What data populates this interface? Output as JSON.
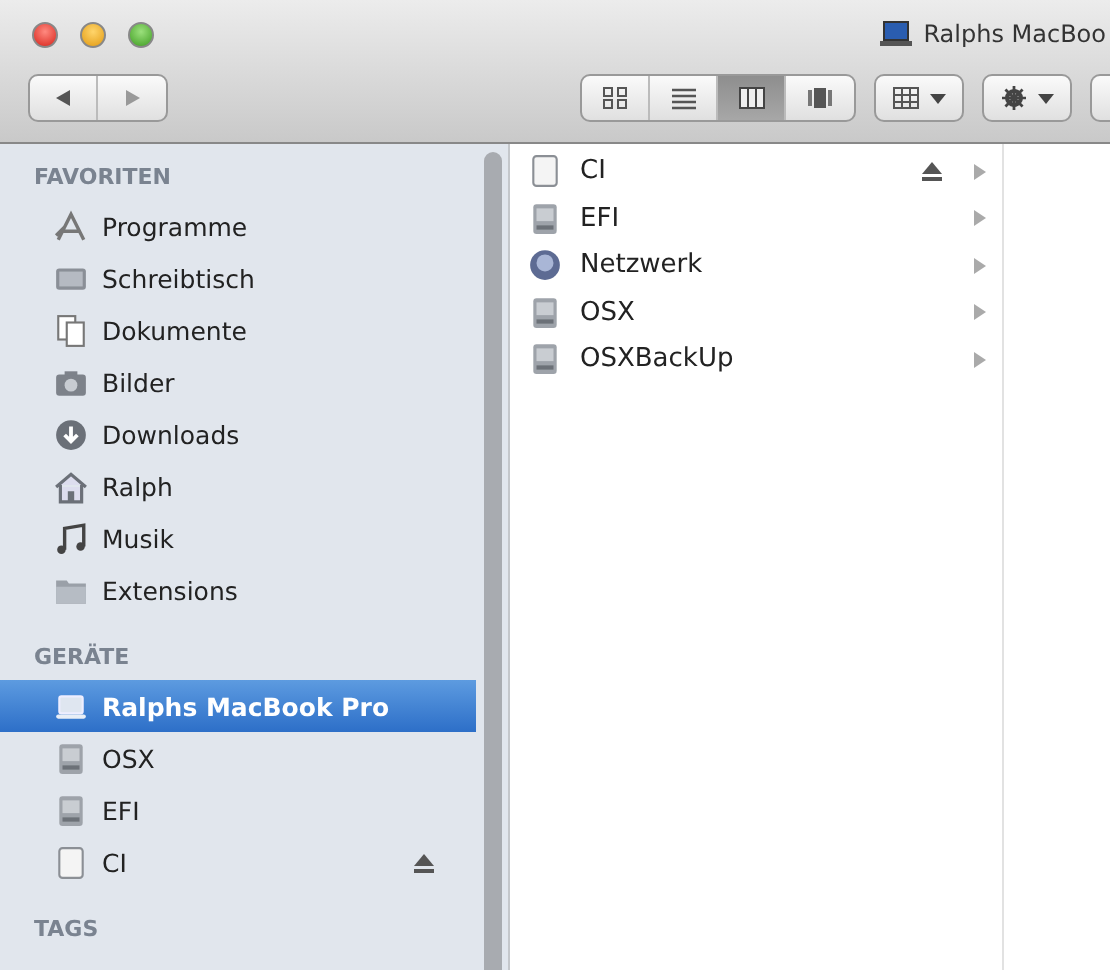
{
  "window": {
    "title": "Ralphs MacBoo"
  },
  "toolbar": {
    "views": [
      {
        "kind": "icons",
        "selected": false
      },
      {
        "kind": "list",
        "selected": false
      },
      {
        "kind": "columns",
        "selected": true
      },
      {
        "kind": "coverflow",
        "selected": false
      }
    ]
  },
  "sidebar": {
    "sections": [
      {
        "title": "FAVORITEN",
        "items": [
          {
            "label": "Programme",
            "kind": "apps",
            "selected": false,
            "eject": false
          },
          {
            "label": "Schreibtisch",
            "kind": "desktop",
            "selected": false,
            "eject": false
          },
          {
            "label": "Dokumente",
            "kind": "docs",
            "selected": false,
            "eject": false
          },
          {
            "label": "Bilder",
            "kind": "camera",
            "selected": false,
            "eject": false
          },
          {
            "label": "Downloads",
            "kind": "download",
            "selected": false,
            "eject": false
          },
          {
            "label": "Ralph",
            "kind": "home",
            "selected": false,
            "eject": false
          },
          {
            "label": "Musik",
            "kind": "music",
            "selected": false,
            "eject": false
          },
          {
            "label": "Extensions",
            "kind": "folder",
            "selected": false,
            "eject": false
          }
        ]
      },
      {
        "title": "GERÄTE",
        "items": [
          {
            "label": "Ralphs MacBook Pro",
            "kind": "laptop",
            "selected": true,
            "eject": false
          },
          {
            "label": "OSX",
            "kind": "disk",
            "selected": false,
            "eject": false
          },
          {
            "label": "EFI",
            "kind": "disk",
            "selected": false,
            "eject": false
          },
          {
            "label": "CI",
            "kind": "blank",
            "selected": false,
            "eject": true
          }
        ]
      },
      {
        "title": "TAGS"
      }
    ]
  },
  "column": {
    "items": [
      {
        "label": "CI",
        "kind": "blank",
        "eject": true
      },
      {
        "label": "EFI",
        "kind": "disk",
        "eject": false
      },
      {
        "label": "Netzwerk",
        "kind": "network",
        "eject": false
      },
      {
        "label": "OSX",
        "kind": "disk",
        "eject": false
      },
      {
        "label": "OSXBackUp",
        "kind": "disk",
        "eject": false
      }
    ]
  }
}
